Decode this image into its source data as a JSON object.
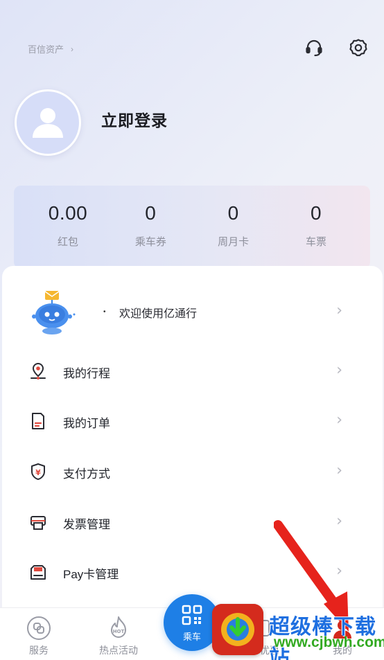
{
  "header": {
    "breadcrumb_label": "百信资产",
    "breadcrumb_chevron": "›",
    "support_icon": "headset-icon",
    "settings_icon": "gear-icon"
  },
  "profile": {
    "avatar_icon": "user-avatar-icon",
    "login_label": "立即登录"
  },
  "stats": [
    {
      "value": "0.00",
      "label": "红包"
    },
    {
      "value": "0",
      "label": "乘车券"
    },
    {
      "value": "0",
      "label": "周月卡"
    },
    {
      "value": "0",
      "label": "车票"
    }
  ],
  "welcome": {
    "bullet": "•",
    "text": "欢迎使用亿通行"
  },
  "menu": [
    {
      "label": "我的行程",
      "icon": "location-pin-icon"
    },
    {
      "label": "我的订单",
      "icon": "order-doc-icon"
    },
    {
      "label": "支付方式",
      "icon": "yuan-shield-icon"
    },
    {
      "label": "发票管理",
      "icon": "printer-icon"
    },
    {
      "label": "Pay卡管理",
      "icon": "pay-card-icon"
    }
  ],
  "chevron": "›",
  "bottom_nav": {
    "services": "服务",
    "hot": "热点活动",
    "ride": "乘车",
    "coupon": "乘车优惠",
    "mine": "我的"
  },
  "watermark": {
    "title": "超级棒下载站",
    "url": "www.cjbwh.com"
  },
  "colors": {
    "accent": "#1e7fe6",
    "icon_red": "#e04a3f",
    "watermark_blue": "#1e6fe0",
    "watermark_green": "#33aa22"
  }
}
